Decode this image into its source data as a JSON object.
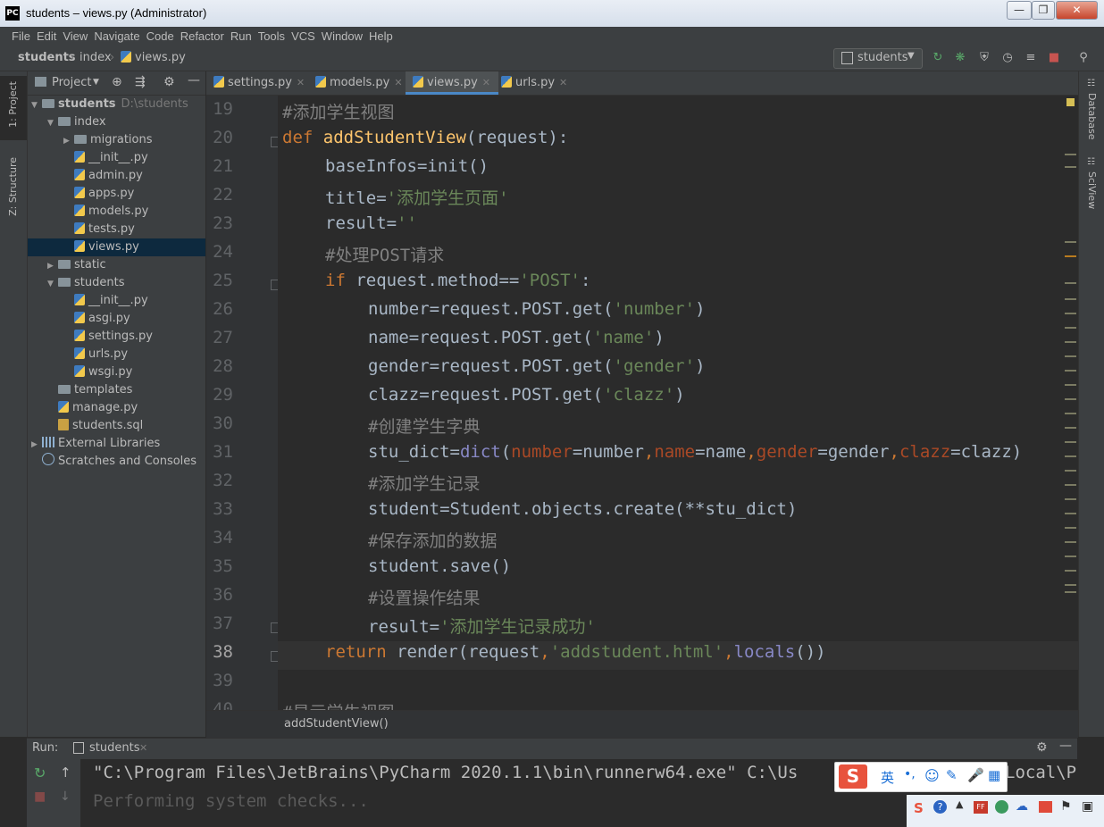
{
  "window": {
    "title": "students – views.py (Administrator)",
    "app_icon": "PC",
    "controls": [
      "minimize",
      "maximize",
      "close"
    ]
  },
  "menu": [
    "File",
    "Edit",
    "View",
    "Navigate",
    "Code",
    "Refactor",
    "Run",
    "Tools",
    "VCS",
    "Window",
    "Help"
  ],
  "navbar": {
    "breadcrumbs": [
      "students",
      "index",
      "views.py"
    ],
    "run_config": "students"
  },
  "left_stripe": {
    "project_tab": "1: Project",
    "structure_tab": "Z: Structure"
  },
  "right_stripe": {
    "database_tab": "Database",
    "sciview_tab": "SciView"
  },
  "project": {
    "header": "Project",
    "tree": [
      {
        "label": "students",
        "extra": "D:\\students",
        "depth": 0,
        "icon": "folder",
        "expanded": true
      },
      {
        "label": "index",
        "depth": 1,
        "icon": "folder",
        "expanded": true
      },
      {
        "label": "migrations",
        "depth": 2,
        "icon": "folder",
        "collapsed": true
      },
      {
        "label": "__init__.py",
        "depth": 2,
        "icon": "py"
      },
      {
        "label": "admin.py",
        "depth": 2,
        "icon": "py"
      },
      {
        "label": "apps.py",
        "depth": 2,
        "icon": "py"
      },
      {
        "label": "models.py",
        "depth": 2,
        "icon": "py"
      },
      {
        "label": "tests.py",
        "depth": 2,
        "icon": "py"
      },
      {
        "label": "views.py",
        "depth": 2,
        "icon": "py",
        "selected": true
      },
      {
        "label": "static",
        "depth": 1,
        "icon": "folder",
        "collapsed": true
      },
      {
        "label": "students",
        "depth": 1,
        "icon": "folder",
        "expanded": true
      },
      {
        "label": "__init__.py",
        "depth": 2,
        "icon": "py"
      },
      {
        "label": "asgi.py",
        "depth": 2,
        "icon": "py"
      },
      {
        "label": "settings.py",
        "depth": 2,
        "icon": "py"
      },
      {
        "label": "urls.py",
        "depth": 2,
        "icon": "py"
      },
      {
        "label": "wsgi.py",
        "depth": 2,
        "icon": "py"
      },
      {
        "label": "templates",
        "depth": 1,
        "icon": "folder"
      },
      {
        "label": "manage.py",
        "depth": 1,
        "icon": "py"
      },
      {
        "label": "students.sql",
        "depth": 1,
        "icon": "sql"
      },
      {
        "label": "External Libraries",
        "depth": 0,
        "icon": "lib",
        "collapsed": true
      },
      {
        "label": "Scratches and Consoles",
        "depth": 0,
        "icon": "scratch"
      }
    ]
  },
  "tabs": [
    {
      "label": "settings.py"
    },
    {
      "label": "models.py"
    },
    {
      "label": "views.py",
      "active": true
    },
    {
      "label": "urls.py"
    }
  ],
  "editor": {
    "current_line": 38,
    "lines": [
      {
        "n": "19",
        "indent": 0,
        "tokens": [
          [
            "cmt",
            "#添加学生视图"
          ]
        ]
      },
      {
        "n": "20",
        "indent": 0,
        "tokens": [
          [
            "kw",
            "def "
          ],
          [
            "fn",
            "addStudentView"
          ],
          [
            "",
            "(request):"
          ]
        ]
      },
      {
        "n": "21",
        "indent": 1,
        "tokens": [
          [
            "",
            "baseInfos=init()"
          ]
        ]
      },
      {
        "n": "22",
        "indent": 1,
        "tokens": [
          [
            "",
            "title="
          ],
          [
            "str",
            "'添加学生页面'"
          ]
        ]
      },
      {
        "n": "23",
        "indent": 1,
        "tokens": [
          [
            "",
            "result="
          ],
          [
            "str",
            "''"
          ]
        ]
      },
      {
        "n": "24",
        "indent": 1,
        "tokens": [
          [
            "cmt",
            "#处理POST请求"
          ]
        ]
      },
      {
        "n": "25",
        "indent": 1,
        "tokens": [
          [
            "kw",
            "if "
          ],
          [
            "",
            "request.method=="
          ],
          [
            "str",
            "'POST'"
          ],
          [
            "",
            ":"
          ]
        ]
      },
      {
        "n": "26",
        "indent": 2,
        "tokens": [
          [
            "",
            "number=request.POST.get("
          ],
          [
            "str",
            "'number'"
          ],
          [
            "",
            ")"
          ]
        ]
      },
      {
        "n": "27",
        "indent": 2,
        "tokens": [
          [
            "",
            "name=request.POST.get("
          ],
          [
            "str",
            "'name'"
          ],
          [
            "",
            ")"
          ]
        ]
      },
      {
        "n": "28",
        "indent": 2,
        "tokens": [
          [
            "",
            "gender=request.POST.get("
          ],
          [
            "str",
            "'gender'"
          ],
          [
            "",
            ")"
          ]
        ]
      },
      {
        "n": "29",
        "indent": 2,
        "tokens": [
          [
            "",
            "clazz=request.POST.get("
          ],
          [
            "str",
            "'clazz'"
          ],
          [
            "",
            ")"
          ]
        ]
      },
      {
        "n": "30",
        "indent": 2,
        "tokens": [
          [
            "cmt",
            "#创建学生字典"
          ]
        ]
      },
      {
        "n": "31",
        "indent": 2,
        "tokens": [
          [
            "",
            "stu_dict="
          ],
          [
            "bi",
            "dict"
          ],
          [
            "",
            "("
          ],
          [
            "prm",
            "number"
          ],
          [
            "",
            "=number"
          ],
          [
            "kw",
            ","
          ],
          [
            "prm",
            "name"
          ],
          [
            "",
            "=name"
          ],
          [
            "kw",
            ","
          ],
          [
            "prm",
            "gender"
          ],
          [
            "",
            "=gender"
          ],
          [
            "kw",
            ","
          ],
          [
            "prm",
            "clazz"
          ],
          [
            "",
            "=clazz)"
          ]
        ]
      },
      {
        "n": "32",
        "indent": 2,
        "tokens": [
          [
            "cmt",
            "#添加学生记录"
          ]
        ]
      },
      {
        "n": "33",
        "indent": 2,
        "tokens": [
          [
            "",
            "student=Student.objects.create(**stu_dict)"
          ]
        ]
      },
      {
        "n": "34",
        "indent": 2,
        "tokens": [
          [
            "cmt",
            "#保存添加的数据"
          ]
        ]
      },
      {
        "n": "35",
        "indent": 2,
        "tokens": [
          [
            "",
            "student.save()"
          ]
        ]
      },
      {
        "n": "36",
        "indent": 2,
        "tokens": [
          [
            "cmt",
            "#设置操作结果"
          ]
        ]
      },
      {
        "n": "37",
        "indent": 2,
        "tokens": [
          [
            "",
            "result="
          ],
          [
            "str",
            "'添加学生记录成功'"
          ]
        ]
      },
      {
        "n": "38",
        "indent": 1,
        "tokens": [
          [
            "kw",
            "return "
          ],
          [
            "",
            "render(request"
          ],
          [
            "kw",
            ","
          ],
          [
            "str",
            "'addstudent.html'"
          ],
          [
            "kw",
            ","
          ],
          [
            "bi",
            "locals"
          ],
          [
            "",
            "())"
          ]
        ]
      },
      {
        "n": "39",
        "indent": 0,
        "tokens": []
      },
      {
        "n": "40",
        "indent": 0,
        "tokens": [
          [
            "cmt",
            "#显示学生视图"
          ]
        ]
      }
    ],
    "breadcrumb": "addStudentView()"
  },
  "run": {
    "label": "Run:",
    "tab": "students",
    "console": [
      "\"C:\\Program Files\\JetBrains\\PyCharm 2020.1.1\\bin\\runnerw64.exe\" C:\\Us",
      "Performing system checks..."
    ],
    "console_tail": "Local\\P"
  },
  "ime": {
    "logo": "S",
    "mode": "英",
    "punct": "•,",
    "icons": [
      "smiley-icon",
      "pen-icon",
      "mic-icon",
      "grid-icon"
    ]
  },
  "tray": {
    "icons": [
      "sogou-icon",
      "help-icon",
      "arrow-icon",
      "ff-icon",
      "app-icon",
      "cloud-icon",
      "connect-icon",
      "flag-icon",
      "monitor-icon"
    ]
  }
}
